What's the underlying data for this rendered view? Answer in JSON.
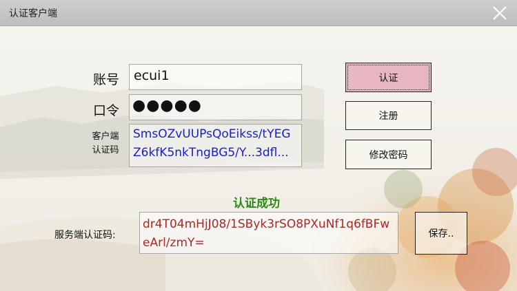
{
  "window": {
    "title": "认证客户端"
  },
  "form": {
    "account_label": "账号",
    "account_value": "ecui1",
    "password_label": "口令",
    "password_mask": "●●●●●",
    "client_code_label_line1": "客户端",
    "client_code_label_line2": "认证码",
    "client_code_value": "SmsOZvUUPsQoEikss/tYEGZ6kfK5nkTngBG5/Y...3dfl..."
  },
  "buttons": {
    "auth": "认证",
    "register": "注册",
    "change_password": "修改密码",
    "save": "保存.."
  },
  "status": {
    "text": "认证成功",
    "color": "#2a8a14"
  },
  "server": {
    "label": "服务端认证码:",
    "code_value": "dr4T04mHjJ08/1SByk3rSO8PXuNf1q6fBFweArl/zmY="
  },
  "colors": {
    "auth_button_bg": "#e9b6c3",
    "client_code_text": "#1a1ad6",
    "server_code_text": "#b02525",
    "status_text": "#2a8a14"
  },
  "icons": {
    "close": "close-icon"
  }
}
